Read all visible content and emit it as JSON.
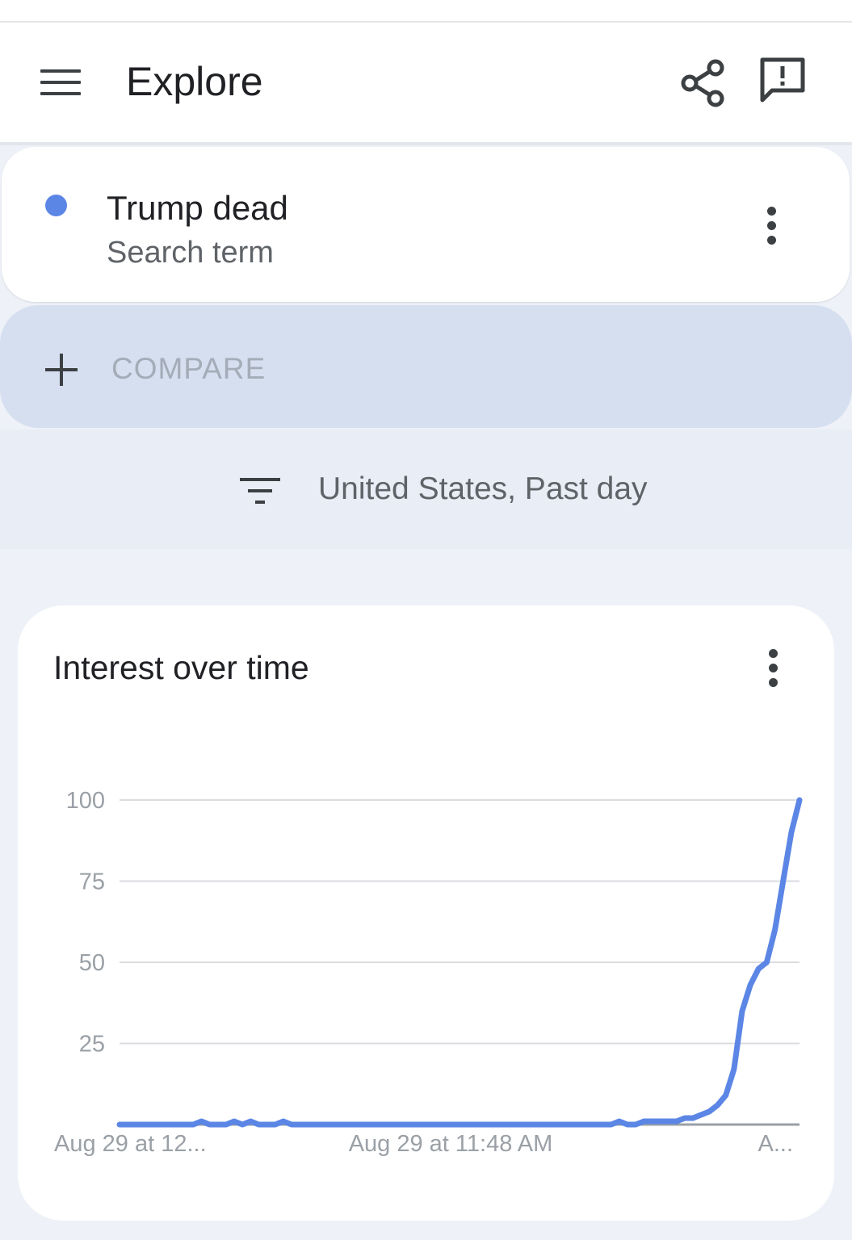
{
  "header": {
    "title": "Explore"
  },
  "term": {
    "name": "Trump dead",
    "type": "Search term",
    "color": "#5b86e5"
  },
  "compare": {
    "label": "COMPARE"
  },
  "filter": {
    "label": "United States, Past day"
  },
  "chart": {
    "title": "Interest over time"
  },
  "chart_data": {
    "type": "line",
    "title": "Interest over time",
    "xlabel": "",
    "ylabel": "",
    "ylim": [
      0,
      100
    ],
    "yticks": [
      100,
      75,
      50,
      25
    ],
    "xtick_labels": [
      "Aug 29 at 12...",
      "Aug 29 at 11:48 AM",
      "A..."
    ],
    "grid": true,
    "series": [
      {
        "color": "#5b86e5",
        "values": [
          0,
          0,
          0,
          0,
          0,
          0,
          0,
          0,
          0,
          0,
          1,
          0,
          0,
          0,
          1,
          0,
          1,
          0,
          0,
          0,
          1,
          0,
          0,
          0,
          0,
          0,
          0,
          0,
          0,
          0,
          0,
          0,
          0,
          0,
          0,
          0,
          0,
          0,
          0,
          0,
          0,
          0,
          0,
          0,
          0,
          0,
          0,
          0,
          0,
          0,
          0,
          0,
          0,
          0,
          0,
          0,
          0,
          0,
          0,
          0,
          0,
          1,
          0,
          0,
          1,
          1,
          1,
          1,
          1,
          2,
          2,
          3,
          4,
          6,
          9,
          17,
          35,
          43,
          48,
          50,
          60,
          75,
          90,
          100
        ]
      }
    ]
  }
}
